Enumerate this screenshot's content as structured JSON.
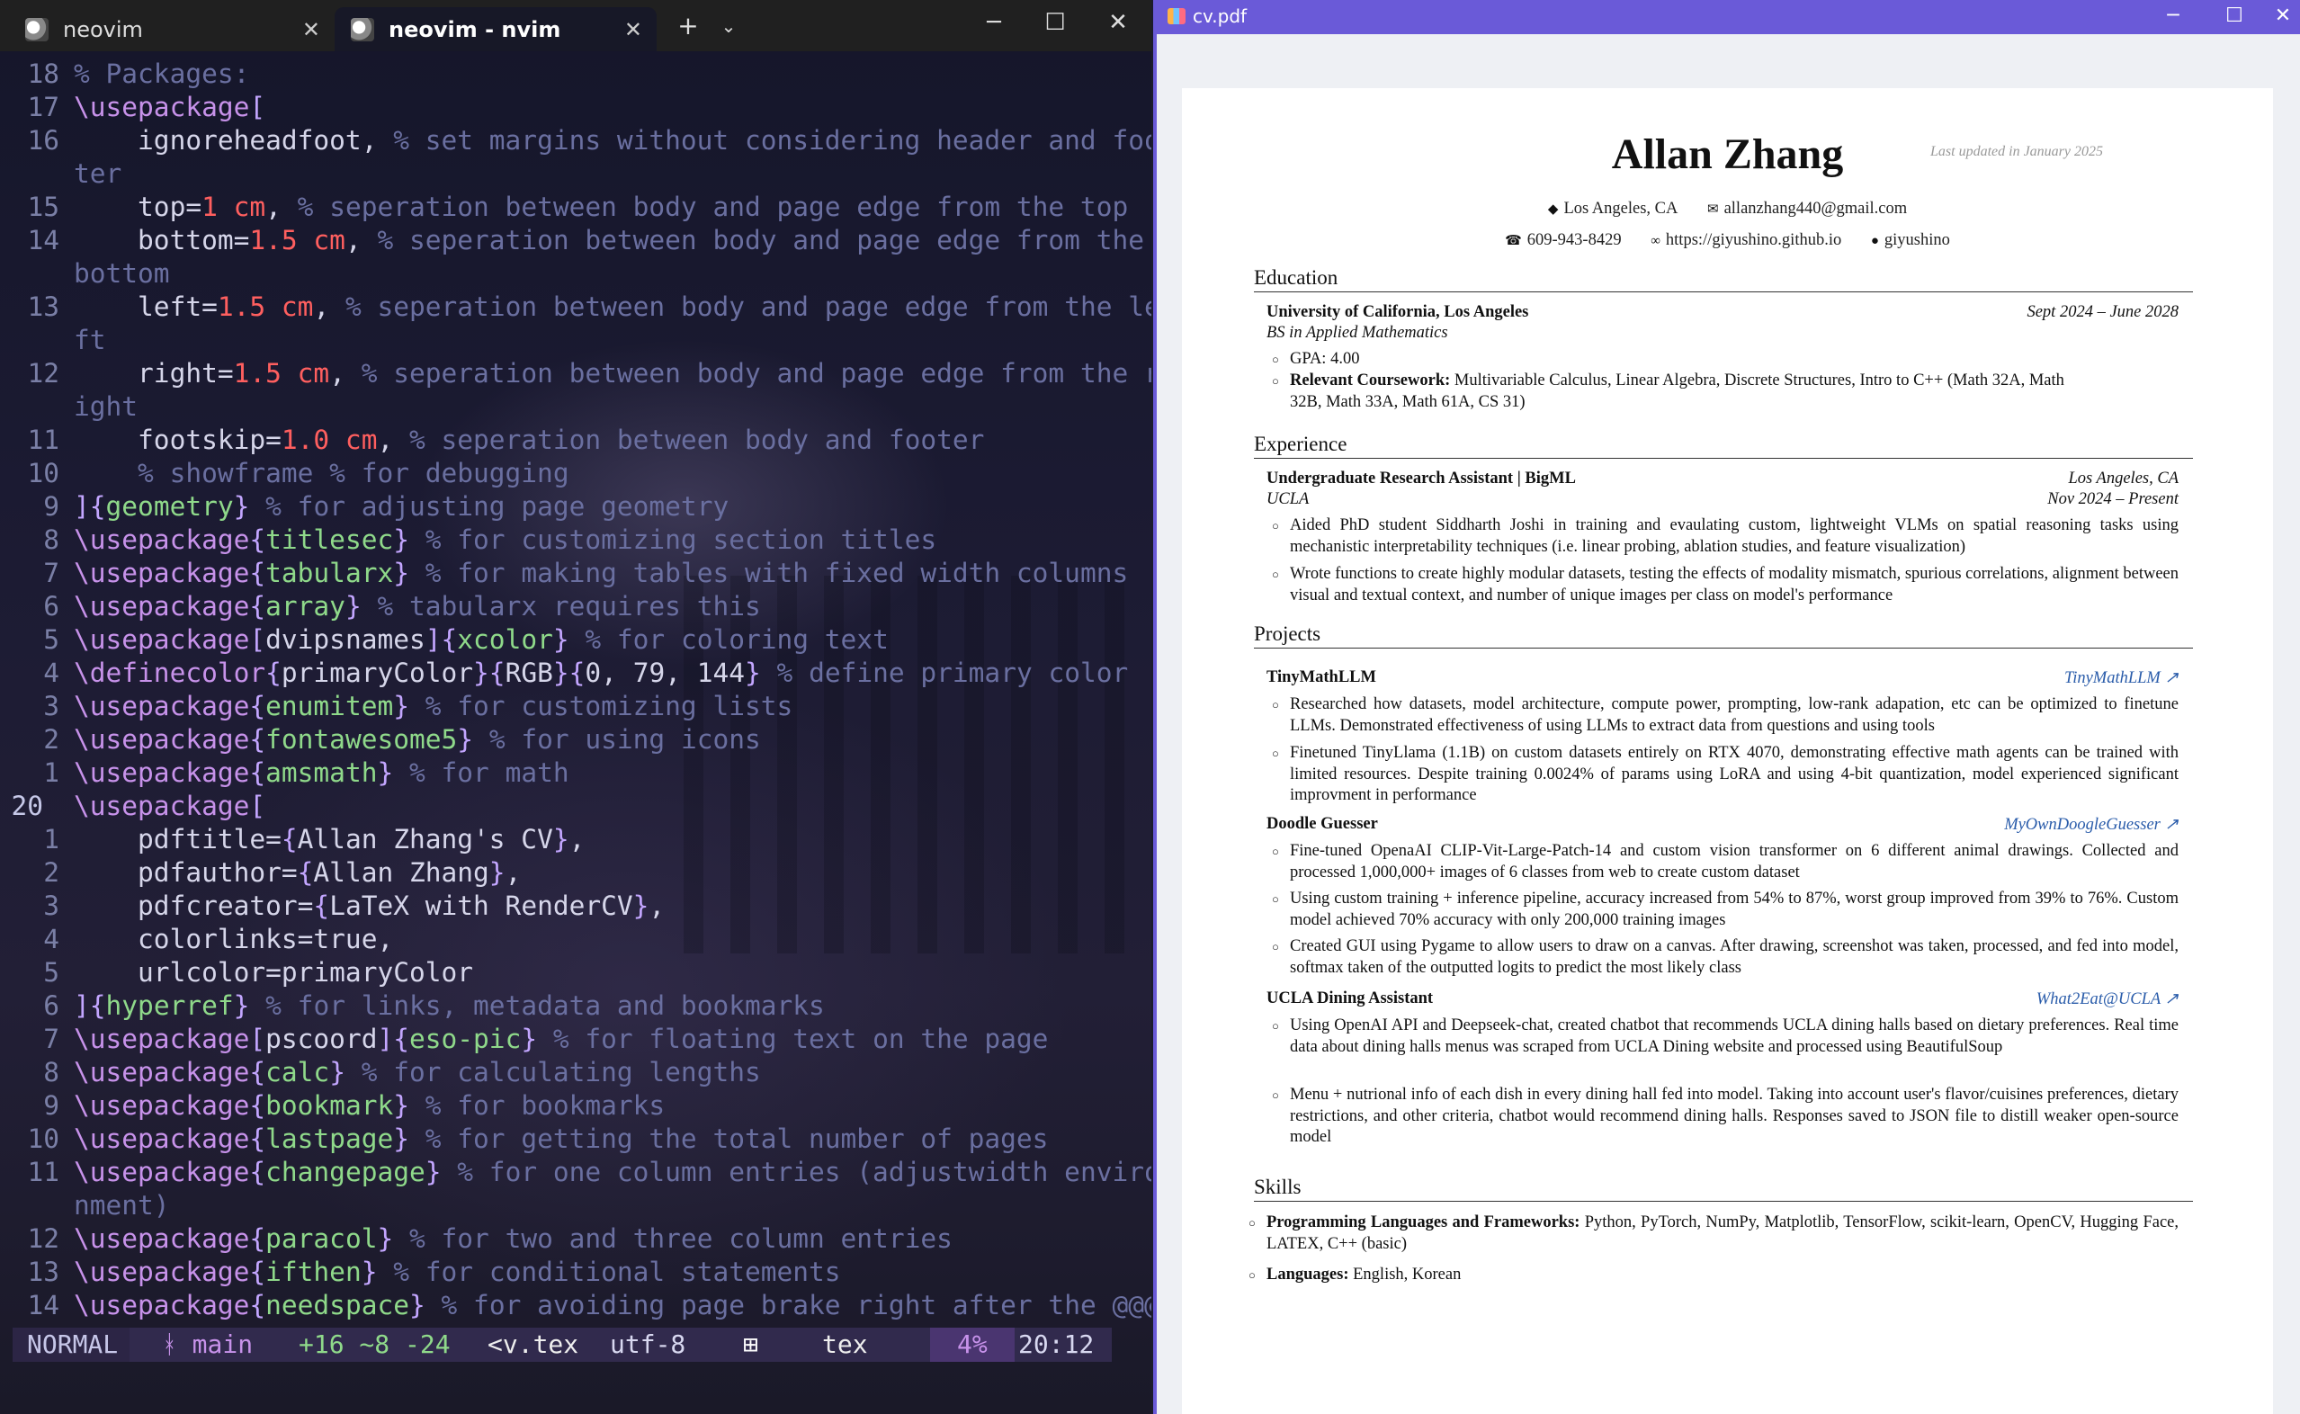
{
  "terminal": {
    "tabs": [
      {
        "label": "neovim"
      },
      {
        "label": "neovim - nvim"
      }
    ],
    "lines": [
      {
        "n": "18",
        "parts": [
          [
            "c",
            "% Packages:"
          ]
        ]
      },
      {
        "n": "17",
        "parts": [
          [
            "k",
            "\\usepackage"
          ],
          [
            "b",
            "["
          ]
        ]
      },
      {
        "n": "16",
        "parts": [
          [
            "t",
            "    ignoreheadfoot, "
          ],
          [
            "c",
            "% set margins without considering header and foo"
          ]
        ]
      },
      {
        "n": "",
        "parts": [
          [
            "c",
            "ter"
          ]
        ]
      },
      {
        "n": "15",
        "parts": [
          [
            "t",
            "    top="
          ],
          [
            "n",
            "1 cm"
          ],
          [
            "t",
            ", "
          ],
          [
            "c",
            "% seperation between body and page edge from the top"
          ]
        ]
      },
      {
        "n": "14",
        "parts": [
          [
            "t",
            "    bottom="
          ],
          [
            "n",
            "1.5 cm"
          ],
          [
            "t",
            ", "
          ],
          [
            "c",
            "% seperation between body and page edge from the"
          ]
        ]
      },
      {
        "n": "",
        "parts": [
          [
            "c",
            "bottom"
          ]
        ]
      },
      {
        "n": "13",
        "parts": [
          [
            "t",
            "    left="
          ],
          [
            "n",
            "1.5 cm"
          ],
          [
            "t",
            ", "
          ],
          [
            "c",
            "% seperation between body and page edge from the le"
          ]
        ]
      },
      {
        "n": "",
        "parts": [
          [
            "c",
            "ft"
          ]
        ]
      },
      {
        "n": "12",
        "parts": [
          [
            "t",
            "    right="
          ],
          [
            "n",
            "1.5 cm"
          ],
          [
            "t",
            ", "
          ],
          [
            "c",
            "% seperation between body and page edge from the r"
          ]
        ]
      },
      {
        "n": "",
        "parts": [
          [
            "c",
            "ight"
          ]
        ]
      },
      {
        "n": "11",
        "parts": [
          [
            "t",
            "    footskip="
          ],
          [
            "n",
            "1.0 cm"
          ],
          [
            "t",
            ", "
          ],
          [
            "c",
            "% seperation between body and footer"
          ]
        ]
      },
      {
        "n": "10",
        "parts": [
          [
            "c",
            "    % showframe % for debugging"
          ]
        ]
      },
      {
        "n": "9",
        "parts": [
          [
            "b",
            "]{"
          ],
          [
            "g",
            "geometry"
          ],
          [
            "b",
            "}"
          ],
          [
            "t",
            " "
          ],
          [
            "c",
            "% for adjusting page geometry"
          ]
        ]
      },
      {
        "n": "8",
        "parts": [
          [
            "k",
            "\\usepackage"
          ],
          [
            "b",
            "{"
          ],
          [
            "g",
            "titlesec"
          ],
          [
            "b",
            "}"
          ],
          [
            "t",
            " "
          ],
          [
            "c",
            "% for customizing section titles"
          ]
        ]
      },
      {
        "n": "7",
        "parts": [
          [
            "k",
            "\\usepackage"
          ],
          [
            "b",
            "{"
          ],
          [
            "g",
            "tabularx"
          ],
          [
            "b",
            "}"
          ],
          [
            "t",
            " "
          ],
          [
            "c",
            "% for making tables with fixed width columns"
          ]
        ]
      },
      {
        "n": "6",
        "parts": [
          [
            "k",
            "\\usepackage"
          ],
          [
            "b",
            "{"
          ],
          [
            "g",
            "array"
          ],
          [
            "b",
            "}"
          ],
          [
            "t",
            " "
          ],
          [
            "c",
            "% tabularx requires this"
          ]
        ]
      },
      {
        "n": "5",
        "parts": [
          [
            "k",
            "\\usepackage"
          ],
          [
            "b",
            "["
          ],
          [
            "t",
            "dvipsnames"
          ],
          [
            "b",
            "]{"
          ],
          [
            "g",
            "xcolor"
          ],
          [
            "b",
            "}"
          ],
          [
            "t",
            " "
          ],
          [
            "c",
            "% for coloring text"
          ]
        ]
      },
      {
        "n": "4",
        "parts": [
          [
            "k",
            "\\definecolor"
          ],
          [
            "b",
            "{"
          ],
          [
            "t",
            "primaryColor"
          ],
          [
            "b",
            "}{"
          ],
          [
            "t",
            "RGB"
          ],
          [
            "b",
            "}{"
          ],
          [
            "t",
            "0, 79, 144"
          ],
          [
            "b",
            "}"
          ],
          [
            "t",
            " "
          ],
          [
            "c",
            "% define primary color"
          ]
        ]
      },
      {
        "n": "3",
        "parts": [
          [
            "k",
            "\\usepackage"
          ],
          [
            "b",
            "{"
          ],
          [
            "g",
            "enumitem"
          ],
          [
            "b",
            "}"
          ],
          [
            "t",
            " "
          ],
          [
            "c",
            "% for customizing lists"
          ]
        ]
      },
      {
        "n": "2",
        "parts": [
          [
            "k",
            "\\usepackage"
          ],
          [
            "b",
            "{"
          ],
          [
            "g",
            "fontawesome5"
          ],
          [
            "b",
            "}"
          ],
          [
            "t",
            " "
          ],
          [
            "c",
            "% for using icons"
          ]
        ]
      },
      {
        "n": "1",
        "parts": [
          [
            "k",
            "\\usepackage"
          ],
          [
            "b",
            "{"
          ],
          [
            "g",
            "amsmath"
          ],
          [
            "b",
            "}"
          ],
          [
            "t",
            " "
          ],
          [
            "c",
            "% for math"
          ]
        ]
      },
      {
        "n": "20",
        "cur": true,
        "parts": [
          [
            "k",
            "\\usepackage"
          ],
          [
            "b",
            "["
          ]
        ]
      },
      {
        "n": "1",
        "parts": [
          [
            "t",
            "    pdftitle="
          ],
          [
            "b",
            "{"
          ],
          [
            "t",
            "Allan Zhang's CV"
          ],
          [
            "b",
            "}"
          ],
          [
            "t",
            ","
          ]
        ]
      },
      {
        "n": "2",
        "parts": [
          [
            "t",
            "    pdfauthor="
          ],
          [
            "b",
            "{"
          ],
          [
            "t",
            "Allan Zhang"
          ],
          [
            "b",
            "}"
          ],
          [
            "t",
            ","
          ]
        ]
      },
      {
        "n": "3",
        "parts": [
          [
            "t",
            "    pdfcreator="
          ],
          [
            "b",
            "{"
          ],
          [
            "t",
            "LaTeX with RenderCV"
          ],
          [
            "b",
            "}"
          ],
          [
            "t",
            ","
          ]
        ]
      },
      {
        "n": "4",
        "parts": [
          [
            "t",
            "    colorlinks=true,"
          ]
        ]
      },
      {
        "n": "5",
        "parts": [
          [
            "t",
            "    urlcolor=primaryColor"
          ]
        ]
      },
      {
        "n": "6",
        "parts": [
          [
            "b",
            "]{"
          ],
          [
            "g",
            "hyperref"
          ],
          [
            "b",
            "}"
          ],
          [
            "t",
            " "
          ],
          [
            "c",
            "% for links, metadata and bookmarks"
          ]
        ]
      },
      {
        "n": "7",
        "parts": [
          [
            "k",
            "\\usepackage"
          ],
          [
            "b",
            "["
          ],
          [
            "t",
            "pscoord"
          ],
          [
            "b",
            "]{"
          ],
          [
            "g",
            "eso-pic"
          ],
          [
            "b",
            "}"
          ],
          [
            "t",
            " "
          ],
          [
            "c",
            "% for floating text on the page"
          ]
        ]
      },
      {
        "n": "8",
        "parts": [
          [
            "k",
            "\\usepackage"
          ],
          [
            "b",
            "{"
          ],
          [
            "g",
            "calc"
          ],
          [
            "b",
            "}"
          ],
          [
            "t",
            " "
          ],
          [
            "c",
            "% for calculating lengths"
          ]
        ]
      },
      {
        "n": "9",
        "parts": [
          [
            "k",
            "\\usepackage"
          ],
          [
            "b",
            "{"
          ],
          [
            "g",
            "bookmark"
          ],
          [
            "b",
            "}"
          ],
          [
            "t",
            " "
          ],
          [
            "c",
            "% for bookmarks"
          ]
        ]
      },
      {
        "n": "10",
        "parts": [
          [
            "k",
            "\\usepackage"
          ],
          [
            "b",
            "{"
          ],
          [
            "g",
            "lastpage"
          ],
          [
            "b",
            "}"
          ],
          [
            "t",
            " "
          ],
          [
            "c",
            "% for getting the total number of pages"
          ]
        ]
      },
      {
        "n": "11",
        "parts": [
          [
            "k",
            "\\usepackage"
          ],
          [
            "b",
            "{"
          ],
          [
            "g",
            "changepage"
          ],
          [
            "b",
            "}"
          ],
          [
            "t",
            " "
          ],
          [
            "c",
            "% for one column entries (adjustwidth enviro"
          ]
        ]
      },
      {
        "n": "",
        "parts": [
          [
            "c",
            "nment)"
          ]
        ]
      },
      {
        "n": "12",
        "parts": [
          [
            "k",
            "\\usepackage"
          ],
          [
            "b",
            "{"
          ],
          [
            "g",
            "paracol"
          ],
          [
            "b",
            "}"
          ],
          [
            "t",
            " "
          ],
          [
            "c",
            "% for two and three column entries"
          ]
        ]
      },
      {
        "n": "13",
        "parts": [
          [
            "k",
            "\\usepackage"
          ],
          [
            "b",
            "{"
          ],
          [
            "g",
            "ifthen"
          ],
          [
            "b",
            "}"
          ],
          [
            "t",
            " "
          ],
          [
            "c",
            "% for conditional statements"
          ]
        ]
      },
      {
        "n": "14",
        "parts": [
          [
            "k",
            "\\usepackage"
          ],
          [
            "b",
            "{"
          ],
          [
            "g",
            "needspace"
          ],
          [
            "b",
            "}"
          ],
          [
            "t",
            " "
          ],
          [
            "c",
            "% for avoiding page brake right after the @@@"
          ]
        ]
      }
    ],
    "status": {
      "mode": "NORMAL",
      "branch": "ᚼ main",
      "diff": "+16 ~8 -24",
      "file": "<v.tex",
      "encoding": "utf-8",
      "os_icon": "windows-icon",
      "filetype": "tex",
      "percent": "4%",
      "position": "20:12"
    }
  },
  "pdf": {
    "window_title": "cv.pdf",
    "name": "Allan Zhang",
    "updated": "Last updated in January 2025",
    "contact_line1": [
      {
        "icon": "location-icon",
        "glyph": "◆",
        "text": "Los Angeles, CA"
      },
      {
        "icon": "email-icon",
        "glyph": "✉",
        "text": "allanzhang440@gmail.com"
      }
    ],
    "contact_line2": [
      {
        "icon": "phone-icon",
        "glyph": "☎",
        "text": "609-943-8429"
      },
      {
        "icon": "link-icon",
        "glyph": "∞",
        "text": "https://giyushino.github.io"
      },
      {
        "icon": "github-icon",
        "glyph": "●",
        "text": "giyushino"
      }
    ],
    "education": {
      "title": "Education",
      "school": "University of California, Los Angeles",
      "dates": "Sept 2024 – June 2028",
      "degree": "BS in Applied Mathematics",
      "gpa": "GPA: 4.00",
      "coursework_label": "Relevant Coursework:",
      "coursework": "Multivariable Calculus, Linear Algebra, Discrete Structures, Intro to C++ (Math 32A, Math 32B, Math 33A, Math 61A, CS 31)"
    },
    "experience": {
      "title": "Experience",
      "role": "Undergraduate Research Assistant | BigML",
      "location": "Los Angeles, CA",
      "org": "UCLA",
      "dates": "Nov 2024 – Present",
      "b1": "Aided PhD student Siddharth Joshi in training and evaulating custom, lightweight VLMs on spatial reasoning tasks using mechanistic interpretability techniques (i.e. linear probing, ablation studies, and feature visualization)",
      "b2": "Wrote functions to create highly modular datasets, testing the effects of modality mismatch, spurious correlations, alignment between visual and textual context, and number of unique images per class on model's performance"
    },
    "projects": {
      "title": "Projects",
      "p1": {
        "name": "TinyMathLLM",
        "link": "TinyMathLLM",
        "b1": "Researched how datasets, model architecture, compute power, prompting, low-rank adapation, etc can be optimized to finetune LLMs. Demonstrated effectiveness of using LLMs to extract data from questions and using tools",
        "b2": "Finetuned TinyLlama (1.1B) on custom datasets entirely on RTX 4070, demonstrating effective math agents can be trained with limited resources. Despite training 0.0024% of params using LoRA and using 4-bit quantization, model experienced significant improvment in performance"
      },
      "p2": {
        "name": "Doodle Guesser",
        "link": "MyOwnDoogleGuesser",
        "b1": "Fine-tuned OpenaAI CLIP-Vit-Large-Patch-14 and custom vision transformer on 6 different animal drawings. Collected and processed 1,000,000+ images of 6 classes from web to create custom dataset",
        "b2": "Using custom training + inference pipeline, accuracy increased from 54% to 87%, worst group improved from 39% to 76%. Custom model achieved 70% accuracy with only 200,000 training images",
        "b3": "Created GUI using Pygame to allow users to draw on a canvas. After drawing, screenshot was taken, processed, and fed into model, softmax taken of the outputted logits to predict the most likely class"
      },
      "p3": {
        "name": "UCLA Dining Assistant",
        "link": "What2Eat@UCLA",
        "b1": "Using OpenAI API and Deepseek-chat, created chatbot that recommends UCLA dining halls based on dietary preferences. Real time data about dining halls menus was scraped from UCLA Dining website and processed using BeautifulSoup",
        "b2": "Menu + nutrional info of each dish in every dining hall fed into model. Taking into account user's flavor/cuisines preferences, dietary restrictions, and other criteria, chatbot would recommend dining halls. Responses saved to JSON file to distill weaker open-source model"
      }
    },
    "skills": {
      "title": "Skills",
      "prog_label": "Programming Languages and Frameworks:",
      "prog": "Python, PyTorch, NumPy, Matplotlib, TensorFlow, scikit-learn, OpenCV, Hugging Face, LATEX, C++ (basic)",
      "lang_label": "Languages:",
      "lang": "English, Korean"
    }
  }
}
